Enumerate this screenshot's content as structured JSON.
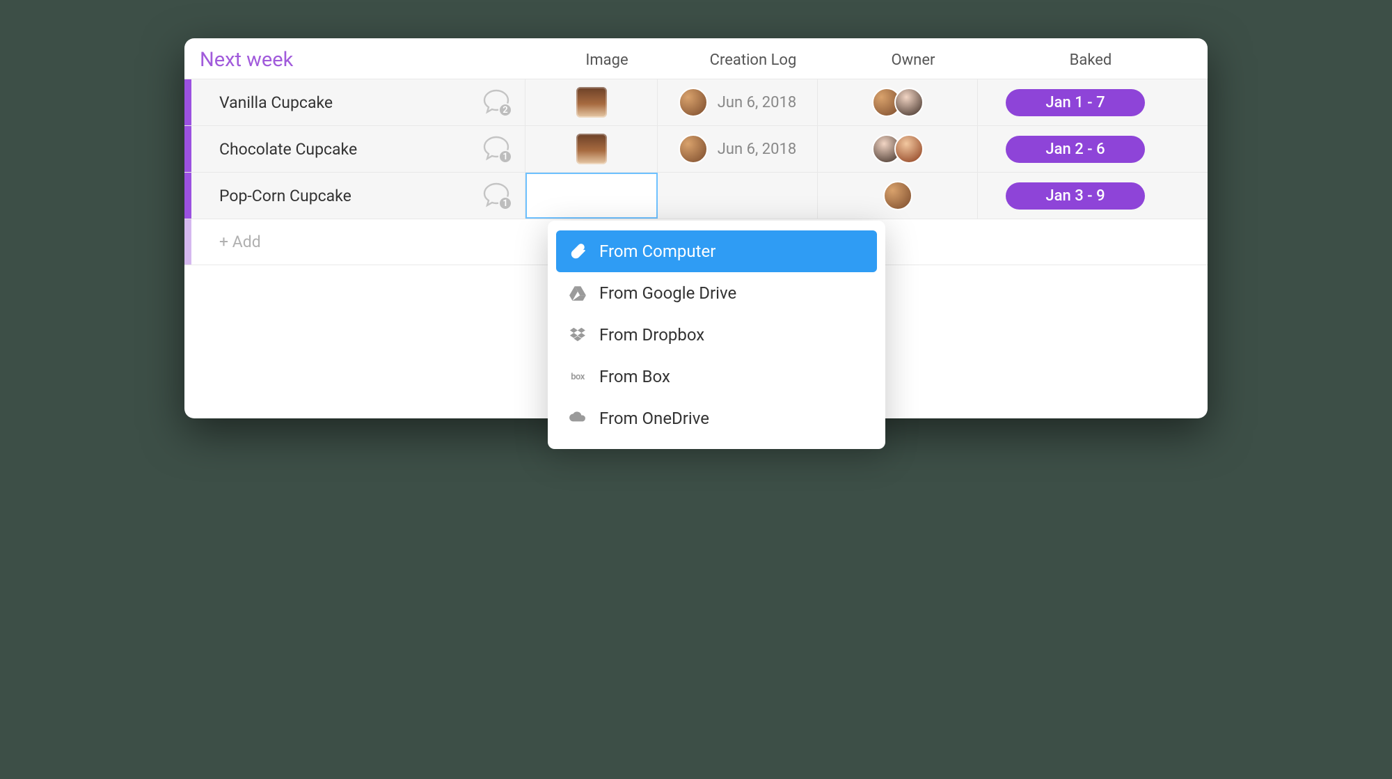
{
  "group": {
    "title": "Next week",
    "accent_color": "#9b51e0"
  },
  "columns": {
    "image": "Image",
    "creation_log": "Creation Log",
    "owner": "Owner",
    "baked": "Baked"
  },
  "rows": [
    {
      "name": "Vanilla Cupcake",
      "comments": "2",
      "creation_date": "Jun 6, 2018",
      "baked": "Jan 1 - 7"
    },
    {
      "name": "Chocolate Cupcake",
      "comments": "1",
      "creation_date": "Jun 6, 2018",
      "baked": "Jan 2 - 6"
    },
    {
      "name": "Pop-Corn Cupcake",
      "comments": "1",
      "baked": "Jan 3 - 9"
    }
  ],
  "add_row_label": "+ Add",
  "upload_menu": {
    "items": [
      {
        "label": "From Computer",
        "icon": "paperclip-icon",
        "selected": true
      },
      {
        "label": "From Google Drive",
        "icon": "google-drive-icon",
        "selected": false
      },
      {
        "label": "From Dropbox",
        "icon": "dropbox-icon",
        "selected": false
      },
      {
        "label": "From Box",
        "icon": "box-icon",
        "selected": false
      },
      {
        "label": "From OneDrive",
        "icon": "onedrive-icon",
        "selected": false
      }
    ]
  }
}
